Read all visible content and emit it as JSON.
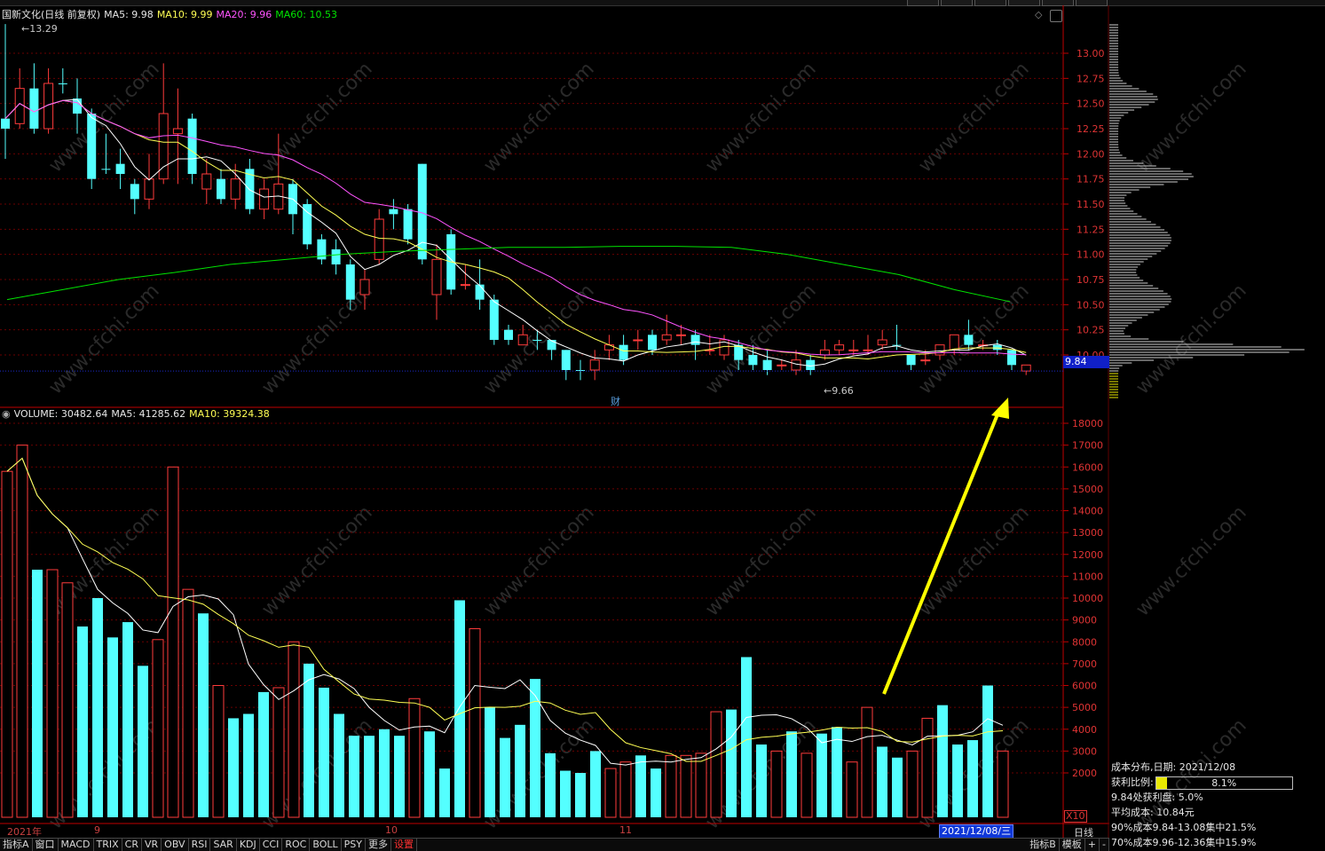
{
  "stock": {
    "title": "国新文化(日线 前复权)"
  },
  "price_legend": {
    "ma5_label": "MA5: 9.98",
    "ma10_label": "MA10: 9.99",
    "ma20_label": "MA20: 9.96",
    "ma60_label": "MA60: 10.53"
  },
  "volume_legend": {
    "volume_label": "VOLUME: 30482.64",
    "ma5_label": "MA5: 41285.62",
    "ma10_label": "MA10: 39324.38"
  },
  "price_axis": {
    "ticks": [
      "13.00",
      "12.75",
      "12.50",
      "12.25",
      "12.00",
      "11.75",
      "11.50",
      "11.25",
      "11.00",
      "10.75",
      "10.50",
      "10.25",
      "10.00"
    ]
  },
  "volume_axis": {
    "ticks": [
      "18000",
      "17000",
      "16000",
      "15000",
      "14000",
      "13000",
      "12000",
      "11000",
      "10000",
      "9000",
      "8000",
      "7000",
      "6000",
      "5000",
      "4000",
      "3000",
      "2000"
    ]
  },
  "current_price": "9.84",
  "high_marker": "13.29",
  "low_marker": "9.66",
  "finance_marker": "财",
  "x10_label": "X10",
  "period_label": "日线",
  "date_axis": {
    "labels": [
      "2021年",
      "9",
      "10",
      "11"
    ],
    "selected_date": "2021/12/08/三"
  },
  "bottom_tabs": [
    "指标A",
    "窗口",
    "MACD",
    "TRIX",
    "CR",
    "VR",
    "OBV",
    "RSI",
    "SAR",
    "KDJ",
    "CCI",
    "ROC",
    "BOLL",
    "PSY",
    "更多",
    "设置"
  ],
  "bottom_right_tabs": [
    "指标B",
    "模板",
    "+",
    "-"
  ],
  "watermark": "www.cfchi.com",
  "cost_panel": {
    "title": "成本分布,日期: 2021/12/08",
    "profit_label": "获利比例:",
    "profit_ratio": "8.1%",
    "profit_fraction": 0.081,
    "line1": "9.84处获利盘: 5.0%",
    "line2": "平均成本: 10.84元",
    "line3": "90%成本9.84-13.08集中21.5%",
    "line4": "70%成本9.96-12.36集中15.9%"
  },
  "colors": {
    "up": "#ff3b3b",
    "down": "#54ffff",
    "ma5": "#ffffff",
    "ma10": "#ffff54",
    "ma20": "#ff54ff",
    "ma60": "#00e400",
    "arrow": "#ffff00",
    "axis": "#c00000"
  },
  "chart_data": [
    {
      "type": "candlestick",
      "title": "国新文化(日线 前复权)",
      "ylim": [
        9.5,
        13.5
      ],
      "candles": [
        [
          12.25,
          12.35,
          11.95,
          13.29,
          "down"
        ],
        [
          12.3,
          12.65,
          12.25,
          12.85,
          "up"
        ],
        [
          12.65,
          12.25,
          12.2,
          12.9,
          "down"
        ],
        [
          12.25,
          12.7,
          12.2,
          12.85,
          "up"
        ],
        [
          12.7,
          12.7,
          12.6,
          12.85,
          "down"
        ],
        [
          12.55,
          12.4,
          12.2,
          12.75,
          "down"
        ],
        [
          12.4,
          11.75,
          11.65,
          12.45,
          "down"
        ],
        [
          11.85,
          11.85,
          11.8,
          12.2,
          "down"
        ],
        [
          11.9,
          11.8,
          11.65,
          12.05,
          "down"
        ],
        [
          11.7,
          11.55,
          11.4,
          11.75,
          "down"
        ],
        [
          11.55,
          11.75,
          11.45,
          12.0,
          "up"
        ],
        [
          11.75,
          12.4,
          11.7,
          12.9,
          "up"
        ],
        [
          12.2,
          12.25,
          11.7,
          12.65,
          "up"
        ],
        [
          12.35,
          11.8,
          11.7,
          12.4,
          "down"
        ],
        [
          11.8,
          11.65,
          11.5,
          11.95,
          "up"
        ],
        [
          11.75,
          11.55,
          11.5,
          11.85,
          "down"
        ],
        [
          11.55,
          11.75,
          11.45,
          11.9,
          "up"
        ],
        [
          11.85,
          11.45,
          11.4,
          11.95,
          "down"
        ],
        [
          11.65,
          11.45,
          11.35,
          11.75,
          "up"
        ],
        [
          11.45,
          11.7,
          11.4,
          12.2,
          "up"
        ],
        [
          11.7,
          11.4,
          11.2,
          11.75,
          "down"
        ],
        [
          11.5,
          11.1,
          11.05,
          11.55,
          "down"
        ],
        [
          11.15,
          10.95,
          10.9,
          11.2,
          "down"
        ],
        [
          11.05,
          10.9,
          10.8,
          11.15,
          "down"
        ],
        [
          10.9,
          10.55,
          10.45,
          10.95,
          "down"
        ],
        [
          10.6,
          10.75,
          10.45,
          10.85,
          "up"
        ],
        [
          10.95,
          11.35,
          10.9,
          11.45,
          "up"
        ],
        [
          11.45,
          11.4,
          11.25,
          11.55,
          "down"
        ],
        [
          11.45,
          11.15,
          11.1,
          11.5,
          "down"
        ],
        [
          11.9,
          10.95,
          10.9,
          11.9,
          "down"
        ],
        [
          10.95,
          10.6,
          10.35,
          11.1,
          "up"
        ],
        [
          11.2,
          10.65,
          10.6,
          11.25,
          "down"
        ],
        [
          10.7,
          10.7,
          10.65,
          10.9,
          "up"
        ],
        [
          10.7,
          10.55,
          10.45,
          10.95,
          "down"
        ],
        [
          10.55,
          10.15,
          10.1,
          10.6,
          "down"
        ],
        [
          10.25,
          10.15,
          10.1,
          10.3,
          "down"
        ],
        [
          10.1,
          10.2,
          10.1,
          10.3,
          "up"
        ],
        [
          10.15,
          10.15,
          10.05,
          10.25,
          "down"
        ],
        [
          10.15,
          10.05,
          9.95,
          10.15,
          "down"
        ],
        [
          10.05,
          9.85,
          9.75,
          10.05,
          "down"
        ],
        [
          9.85,
          9.85,
          9.75,
          9.95,
          "down"
        ],
        [
          9.85,
          9.95,
          9.75,
          10.05,
          "up"
        ],
        [
          10.05,
          10.1,
          9.95,
          10.2,
          "up"
        ],
        [
          10.1,
          9.95,
          9.9,
          10.2,
          "down"
        ],
        [
          10.15,
          10.15,
          10.05,
          10.25,
          "up"
        ],
        [
          10.2,
          10.05,
          10.0,
          10.25,
          "down"
        ],
        [
          10.2,
          10.15,
          10.1,
          10.4,
          "up"
        ],
        [
          10.2,
          10.2,
          10.1,
          10.3,
          "up"
        ],
        [
          10.2,
          10.1,
          9.95,
          10.25,
          "down"
        ],
        [
          10.05,
          10.05,
          10.0,
          10.2,
          "up"
        ],
        [
          10.0,
          10.15,
          9.95,
          10.2,
          "up"
        ],
        [
          10.1,
          9.95,
          9.85,
          10.15,
          "down"
        ],
        [
          10.0,
          9.9,
          9.85,
          10.1,
          "down"
        ],
        [
          9.95,
          9.85,
          9.8,
          10.05,
          "down"
        ],
        [
          9.9,
          9.9,
          9.85,
          9.95,
          "up"
        ],
        [
          9.85,
          9.95,
          9.8,
          10.05,
          "up"
        ],
        [
          9.95,
          9.85,
          9.8,
          10.0,
          "down"
        ],
        [
          10.05,
          10.0,
          9.95,
          10.15,
          "up"
        ],
        [
          10.05,
          10.1,
          10.0,
          10.15,
          "up"
        ],
        [
          10.05,
          10.05,
          10.0,
          10.15,
          "up"
        ],
        [
          10.05,
          10.05,
          10.0,
          10.2,
          "up"
        ],
        [
          10.1,
          10.15,
          10.05,
          10.25,
          "up"
        ],
        [
          10.1,
          10.1,
          10.05,
          10.3,
          "down"
        ],
        [
          10.0,
          9.9,
          9.85,
          10.0,
          "down"
        ],
        [
          9.95,
          9.95,
          9.9,
          10.05,
          "up"
        ],
        [
          10.0,
          10.1,
          9.95,
          10.1,
          "up"
        ],
        [
          10.05,
          10.2,
          10.0,
          10.2,
          "up"
        ],
        [
          10.2,
          10.1,
          10.05,
          10.35,
          "down"
        ],
        [
          10.1,
          10.1,
          10.05,
          10.15,
          "up"
        ],
        [
          10.1,
          10.05,
          10.0,
          10.15,
          "down"
        ],
        [
          10.05,
          9.9,
          9.85,
          10.05,
          "down"
        ],
        [
          9.9,
          9.84,
          9.8,
          9.9,
          "up"
        ]
      ],
      "ma60": [
        10.55,
        10.65,
        10.75,
        10.82,
        10.9,
        10.95,
        11.0,
        11.03,
        11.05,
        11.07,
        11.07,
        11.08,
        11.08,
        11.07,
        11.0,
        10.9,
        10.8,
        10.65,
        10.53
      ]
    },
    {
      "type": "bar",
      "title": "VOLUME",
      "ylim": [
        0,
        18000
      ],
      "values": [
        15800,
        17000,
        11300,
        11300,
        10700,
        8700,
        10000,
        8200,
        8900,
        6900,
        8100,
        16000,
        10400,
        9300,
        6000,
        4500,
        4700,
        5700,
        5900,
        8000,
        7000,
        5900,
        4700,
        3700,
        3700,
        4000,
        3700,
        5400,
        3900,
        2200,
        9900,
        8600,
        5000,
        3600,
        4200,
        6300,
        2900,
        2100,
        2000,
        3000,
        2200,
        2500,
        2800,
        2200,
        2800,
        2800,
        2900,
        4800,
        4900,
        7300,
        3300,
        3000,
        3900,
        2900,
        3800,
        4100,
        2500,
        5000,
        3200,
        2700,
        3000,
        4500,
        5100,
        3300,
        3500,
        6000,
        3000
      ],
      "dirs": [
        "up",
        "up",
        "down",
        "up",
        "up",
        "down",
        "down",
        "down",
        "down",
        "down",
        "up",
        "up",
        "up",
        "down",
        "up",
        "down",
        "down",
        "down",
        "up",
        "up",
        "down",
        "down",
        "down",
        "down",
        "down",
        "down",
        "down",
        "up",
        "down",
        "down",
        "down",
        "up",
        "down",
        "down",
        "down",
        "down",
        "down",
        "down",
        "down",
        "down",
        "up",
        "up",
        "down",
        "down",
        "up",
        "up",
        "up",
        "up",
        "down",
        "down",
        "down",
        "up",
        "down",
        "up",
        "down",
        "down",
        "up",
        "up",
        "down",
        "down",
        "up",
        "up",
        "down",
        "down",
        "down",
        "down",
        "up"
      ]
    }
  ]
}
